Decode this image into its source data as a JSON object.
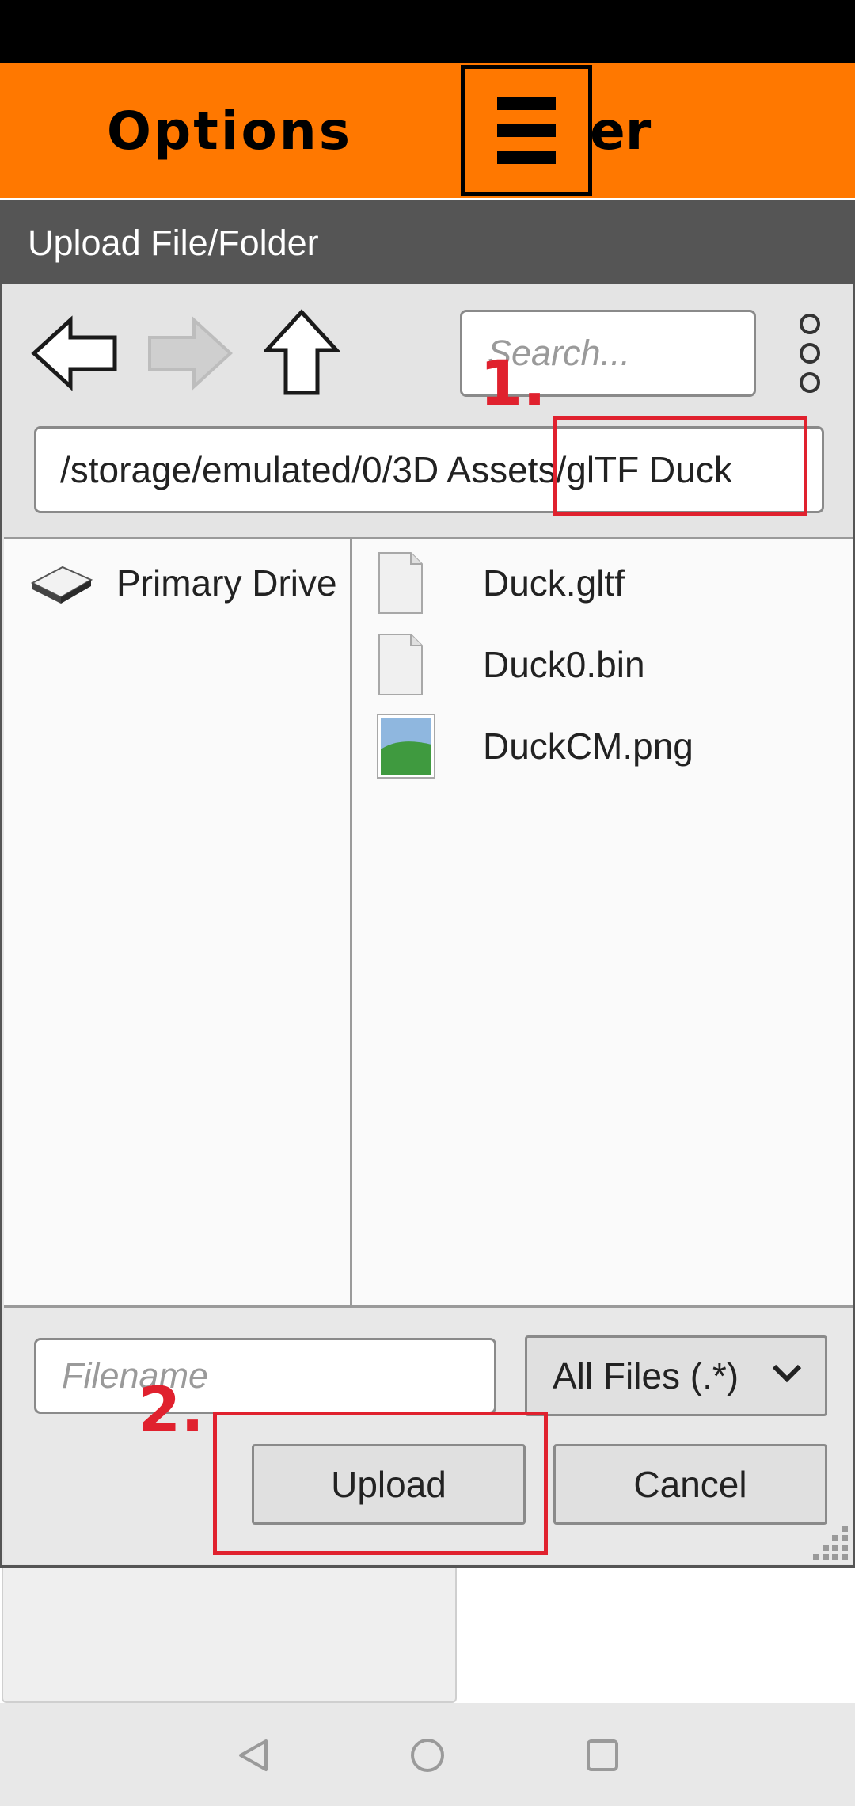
{
  "header": {
    "title": "Options",
    "suffix_text": "er",
    "menu_icon": "hamburger-menu-icon"
  },
  "dialog": {
    "title": "Upload File/Folder",
    "toolbar": {
      "back_icon": "back-arrow-icon",
      "forward_icon": "forward-arrow-icon",
      "up_icon": "up-arrow-icon",
      "search_placeholder": "Search...",
      "overflow_icon": "vertical-dots-icon"
    },
    "path": "/storage/emulated/0/3D Assets/glTF Duck",
    "drives": [
      {
        "label": "Primary Drive",
        "icon": "drive-icon"
      }
    ],
    "files": [
      {
        "name": "Duck.gltf",
        "icon": "file-icon"
      },
      {
        "name": "Duck0.bin",
        "icon": "file-icon"
      },
      {
        "name": "DuckCM.png",
        "icon": "image-file-icon"
      }
    ],
    "filename_placeholder": "Filename",
    "filter_value": "All Files (.*)",
    "upload_label": "Upload",
    "cancel_label": "Cancel"
  },
  "annotations": {
    "step1": "1.",
    "step2": "2.",
    "color": "#e0212e"
  },
  "colors": {
    "accent": "#ff7800",
    "dialog_title_bg": "#555555"
  },
  "system_nav": {
    "back_icon": "nav-back-icon",
    "home_icon": "nav-home-icon",
    "recents_icon": "nav-recents-icon"
  }
}
